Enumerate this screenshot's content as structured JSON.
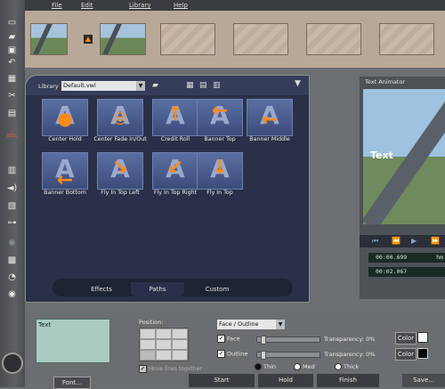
{
  "menu": {
    "file": "File",
    "edit": "Edit",
    "library": "Library",
    "help": "Help"
  },
  "library": {
    "label": "Library",
    "selected": "Default.vwl",
    "tiles": [
      {
        "label": "Center Hold"
      },
      {
        "label": "Center Fade In/Out"
      },
      {
        "label": "Credit Roll"
      },
      {
        "label": "Banner Top"
      },
      {
        "label": "Banner Middle"
      },
      {
        "label": "Banner Bottom"
      },
      {
        "label": "Fly In Top Left"
      },
      {
        "label": "Fly In Top Right"
      },
      {
        "label": "Fly In Top"
      }
    ],
    "tabs": {
      "effects": "Effects",
      "paths": "Paths",
      "custom": "Custom"
    }
  },
  "animator": {
    "title": "Text Animator",
    "preview_text": "Text",
    "time1": "00:00.699",
    "time2": "00:02.067",
    "unit": "hm"
  },
  "editor": {
    "text_value": "Text",
    "position_label": "Position:",
    "move_together": "Move lines together",
    "mode_select": "Face / Outline",
    "face_label": "Face",
    "outline_label": "Outline",
    "transparency_label": "Transparency:",
    "face_transparency": "0%",
    "outline_transparency": "0%",
    "color_btn": "Color",
    "thin": "Thin",
    "med": "Med",
    "thick": "Thick",
    "font_btn": "Font..."
  },
  "footer": {
    "start": "Start",
    "hold": "Hold",
    "finish": "Finish",
    "save": "Save..."
  }
}
